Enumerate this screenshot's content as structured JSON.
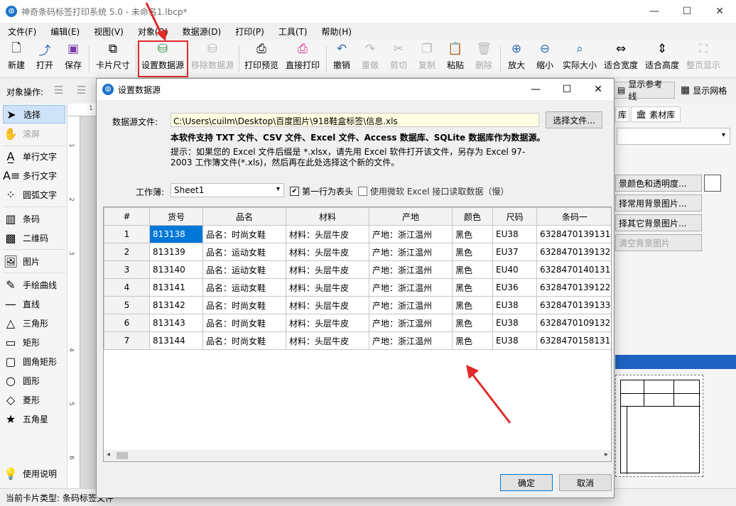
{
  "window": {
    "title": "神奇条码标签打印系统 5.0 - 未命名1.lbcp*",
    "controls": [
      "—",
      "☐",
      "✕"
    ]
  },
  "menu": [
    "文件(F)",
    "编辑(E)",
    "视图(V)",
    "对象(O)",
    "数据源(D)",
    "打印(P)",
    "工具(T)",
    "帮助(H)"
  ],
  "toolbar": {
    "new": "新建",
    "open": "打开",
    "save": "保存",
    "card_size": "卡片尺寸",
    "set_datasource": "设置数据源",
    "remove_datasource": "移除数据源",
    "print_preview": "打印预览",
    "direct_print": "直接打印",
    "undo": "撤销",
    "redo": "重做",
    "cut": "剪切",
    "copy": "复制",
    "paste": "粘贴",
    "delete": "删除",
    "zoom_in": "放大",
    "zoom_out": "缩小",
    "actual_size": "实际大小",
    "fit_width": "适合宽度",
    "fit_height": "适合高度",
    "full_page": "整页显示"
  },
  "object_bar": {
    "label": "对象操作:",
    "show_ref_lines": "显示参考线",
    "show_grid": "显示网格"
  },
  "tools": {
    "select": "选择",
    "scroll": "滚屏",
    "single_text": "单行文字",
    "multi_text": "多行文字",
    "arc_text": "圆弧文字",
    "barcode": "条码",
    "qrcode": "二维码",
    "image": "图片",
    "freehand": "手绘曲线",
    "line": "直线",
    "triangle": "三角形",
    "rect": "矩形",
    "round_rect": "圆角矩形",
    "circle": "圆形",
    "diamond": "菱形",
    "star": "五角星",
    "help": "使用说明"
  },
  "ruler": {
    "top": "1",
    "left": [
      "1",
      "2",
      "3",
      "4",
      "5",
      "6"
    ]
  },
  "right_panel": {
    "tab1": "库",
    "tab2": "素材库",
    "btn_bg_color": "景颜色和透明度...",
    "btn_common_bg": "择常用背景图片...",
    "btn_other_bg": "择其它背景图片...",
    "btn_clear_bg": "清空背景图片"
  },
  "statusbar": {
    "text": "当前卡片类型: 条码标签文件"
  },
  "dialog": {
    "title": "设置数据源",
    "file_label": "数据源文件:",
    "file_path": "C:\\Users\\cuilm\\Desktop\\百度图片\\918鞋盒标签\\信息.xls",
    "choose_file": "选择文件...",
    "support_note": "本软件支持 TXT 文件、CSV 文件、Excel 文件、Access 数据库、SQLite 数据库作为数据源。",
    "hint": "提示：如果您的 Excel 文件后缀是 *.xlsx，请先用 Excel 软件打开该文件，另存为 Excel 97-2003 工作簿文件(*.xls)，然后再在此处选择这个新的文件。",
    "sheet_label": "工作薄:",
    "sheet_value": "Sheet1",
    "first_row_header": "第一行为表头",
    "use_ms_excel": "使用微软 Excel 接口读取数据（慢）",
    "ok": "确定",
    "cancel": "取消",
    "columns": [
      "#",
      "货号",
      "品名",
      "材料",
      "产地",
      "颜色",
      "尺码",
      "条码一"
    ],
    "rows": [
      [
        "1",
        "813138",
        "品名：时尚女鞋",
        "材料：头层牛皮",
        "产地：浙江温州",
        "黑色",
        "EU38",
        "6328470139131"
      ],
      [
        "2",
        "813139",
        "品名：运动女鞋",
        "材料：头层牛皮",
        "产地：浙江温州",
        "黑色",
        "EU37",
        "6328470139132"
      ],
      [
        "3",
        "813140",
        "品名：运动女鞋",
        "材料：头层牛皮",
        "产地：浙江温州",
        "黑色",
        "EU40",
        "6328470140131"
      ],
      [
        "4",
        "813141",
        "品名：运动女鞋",
        "材料：头层牛皮",
        "产地：浙江温州",
        "黑色",
        "EU36",
        "6328470139122"
      ],
      [
        "5",
        "813142",
        "品名：时尚女鞋",
        "材料：头层牛皮",
        "产地：浙江温州",
        "黑色",
        "EU38",
        "6328470139133"
      ],
      [
        "6",
        "813143",
        "品名：时尚女鞋",
        "材料：头层牛皮",
        "产地：浙江温州",
        "黑色",
        "EU38",
        "6328470109132"
      ],
      [
        "7",
        "813144",
        "品名：时尚女鞋",
        "材料：头层牛皮",
        "产地：浙江温州",
        "黑色",
        "EU38",
        "6328470158131"
      ]
    ]
  },
  "colors": {
    "accent": "#0078d7",
    "annotation": "#e02a2a"
  }
}
